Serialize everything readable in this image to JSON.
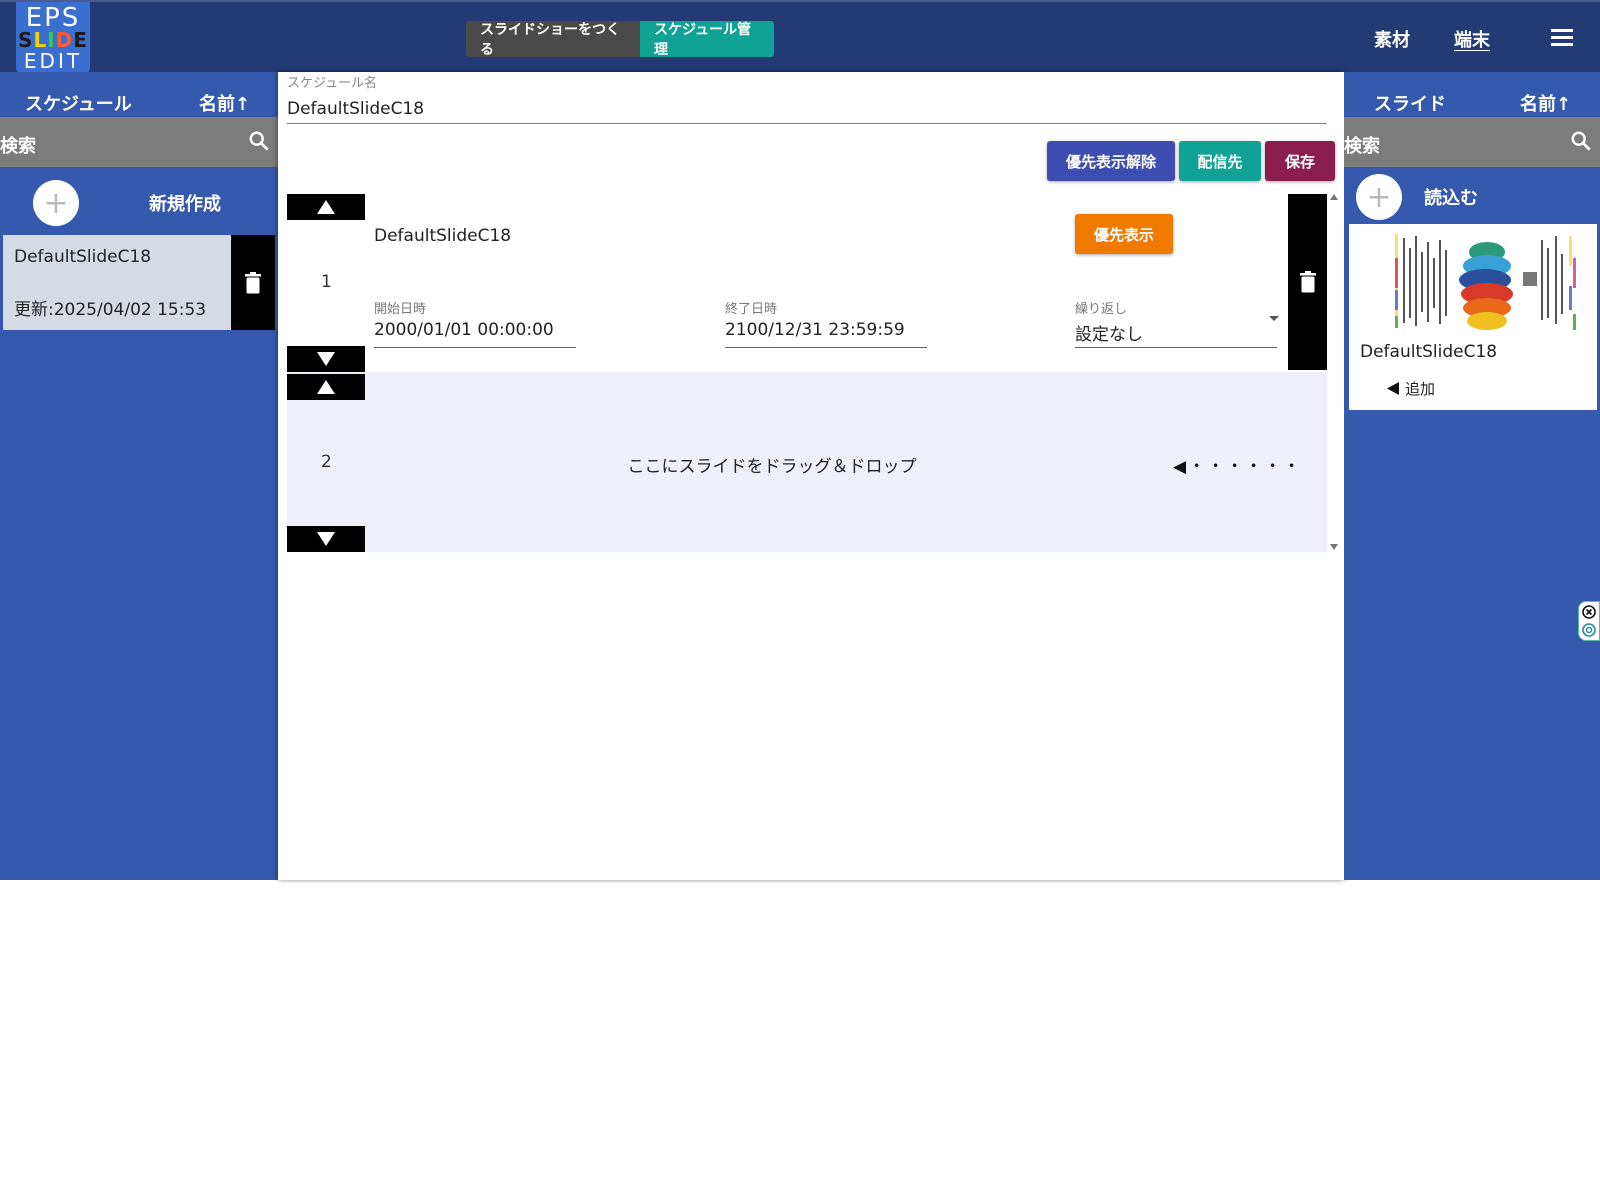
{
  "header": {
    "logo": {
      "line1": "EPS",
      "line2": [
        "S",
        "L",
        "I",
        "D",
        "E"
      ],
      "line3": "EDIT"
    },
    "mode_tabs": [
      "スライドショーをつくる",
      "スケジュール管理"
    ],
    "nav": {
      "materials": "素材",
      "devices": "端末"
    },
    "menu_icon": "hamburger-icon"
  },
  "left": {
    "title": "スケジュール",
    "sort": "名前↑",
    "search_placeholder": "検索",
    "new_label": "新規作成",
    "items": [
      {
        "name": "DefaultSlideC18",
        "updated": "更新:2025/04/02 15:53"
      }
    ]
  },
  "center": {
    "name_label": "スケジュール名",
    "name_value": "DefaultSlideC18",
    "buttons": {
      "unprioritize": "優先表示解除",
      "destination": "配信先",
      "save": "保存"
    },
    "rows": [
      {
        "index": "1",
        "title": "DefaultSlideC18",
        "priority_label": "優先表示",
        "start_label": "開始日時",
        "start_value": "2000/01/01 00:00:00",
        "end_label": "終了日時",
        "end_value": "2100/12/31 23:59:59",
        "repeat_label": "繰り返し",
        "repeat_value": "設定なし"
      },
      {
        "index": "2",
        "drop_text": "ここにスライドをドラッグ＆ドロップ",
        "drop_hint": "◀・・・・・・"
      }
    ]
  },
  "right": {
    "title": "スライド",
    "sort": "名前↑",
    "search_placeholder": "検索",
    "load_label": "読込む",
    "slides": [
      {
        "name": "DefaultSlideC18",
        "add_label": "追加"
      }
    ]
  },
  "colors": {
    "header_bg": "#243a74",
    "panel_bg": "#3559ad",
    "tab_active": "#10a395",
    "btn_unprioritize": "#3e4db0",
    "btn_destination": "#10a395",
    "btn_save": "#8a1f4e",
    "btn_priority": "#f07a00"
  }
}
